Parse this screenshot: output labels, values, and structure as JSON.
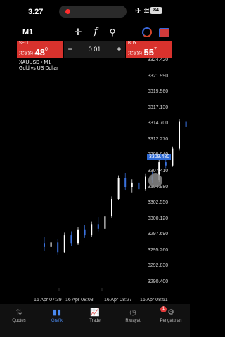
{
  "status_bar": {
    "time": "3.27",
    "battery": "84"
  },
  "toolbar": {
    "timeframe": "M1",
    "icons": [
      "crosshair-icon",
      "function-icon",
      "indicators-icon",
      "chart-type-icon",
      "trade-icon"
    ]
  },
  "trade_panel": {
    "sell": {
      "label": "SELL",
      "price_main": "3309.",
      "price_big": "48",
      "price_sup": "0"
    },
    "buy": {
      "label": "BUY",
      "price_main": "3309.",
      "price_big": "55",
      "price_sup": "7"
    },
    "lot": "0.01",
    "minus": "−",
    "plus": "+"
  },
  "chart": {
    "symbol": "XAUUSD • M1",
    "description": "Gold vs US Dollar",
    "current_price": "3309.480",
    "y_ticks": [
      "3324.420",
      "3321.990",
      "3319.560",
      "3317.130",
      "3314.700",
      "3312.270",
      "3309.840",
      "3307.410",
      "3304.980",
      "3302.550",
      "3300.120",
      "3297.690",
      "3295.260",
      "3292.830",
      "3290.400"
    ],
    "x_ticks": [
      "16 Apr 07:39",
      "16 Apr 08:03",
      "16 Apr 08:27",
      "16 Apr 08:51"
    ],
    "colors": {
      "up": "#ffffff",
      "down": "#3a72e0",
      "price_line": "#3a72e0"
    }
  },
  "chart_data": {
    "type": "candlestick",
    "ylim": [
      3290.4,
      3324.42
    ],
    "ohlc": [
      [
        3296.4,
        3297.3,
        3295.2,
        3295.8
      ],
      [
        3295.8,
        3296.9,
        3294.8,
        3296.5
      ],
      [
        3296.5,
        3297.0,
        3294.6,
        3295.0
      ],
      [
        3295.0,
        3298.0,
        3294.9,
        3297.6
      ],
      [
        3297.6,
        3298.2,
        3296.0,
        3296.4
      ],
      [
        3296.4,
        3298.9,
        3296.1,
        3298.5
      ],
      [
        3298.5,
        3299.2,
        3297.2,
        3297.6
      ],
      [
        3297.6,
        3299.7,
        3297.3,
        3299.3
      ],
      [
        3299.3,
        3300.4,
        3298.2,
        3298.6
      ],
      [
        3298.6,
        3300.9,
        3298.4,
        3300.5
      ],
      [
        3300.5,
        3303.6,
        3300.2,
        3303.2
      ],
      [
        3303.2,
        3306.8,
        3303.0,
        3306.4
      ],
      [
        3306.4,
        3307.1,
        3304.5,
        3305.0
      ],
      [
        3305.0,
        3306.2,
        3304.1,
        3305.7
      ],
      [
        3305.7,
        3306.5,
        3304.3,
        3304.7
      ],
      [
        3304.7,
        3307.0,
        3304.4,
        3306.6
      ],
      [
        3306.6,
        3307.3,
        3305.6,
        3306.1
      ],
      [
        3306.1,
        3309.2,
        3305.8,
        3308.8
      ],
      [
        3308.8,
        3309.7,
        3307.9,
        3308.3
      ],
      [
        3308.3,
        3311.2,
        3308.1,
        3310.9
      ],
      [
        3310.9,
        3315.4,
        3310.6,
        3315.0
      ],
      [
        3315.0,
        3317.8,
        3313.9,
        3314.2
      ],
      [
        3314.2,
        3318.2,
        3313.6,
        3312.7
      ],
      [
        3312.7,
        3313.9,
        3311.2,
        3311.6
      ],
      [
        3311.6,
        3315.3,
        3311.3,
        3314.9
      ],
      [
        3314.9,
        3315.6,
        3313.1,
        3313.4
      ],
      [
        3313.4,
        3314.6,
        3310.3,
        3310.8
      ],
      [
        3310.8,
        3313.6,
        3310.5,
        3313.1
      ],
      [
        3313.1,
        3314.5,
        3309.4,
        3309.5
      ]
    ]
  },
  "nav": [
    {
      "label": "Quotes",
      "icon": "quotes-icon",
      "glyph": "⇅"
    },
    {
      "label": "Grafik",
      "icon": "chart-icon",
      "glyph": "▮▮"
    },
    {
      "label": "Trade",
      "icon": "trade-nav-icon",
      "glyph": "📈"
    },
    {
      "label": "Riwayat",
      "icon": "history-icon",
      "glyph": "◷"
    },
    {
      "label": "Pengaturan",
      "icon": "settings-icon",
      "glyph": "⚙"
    }
  ],
  "nav_badge": "1"
}
